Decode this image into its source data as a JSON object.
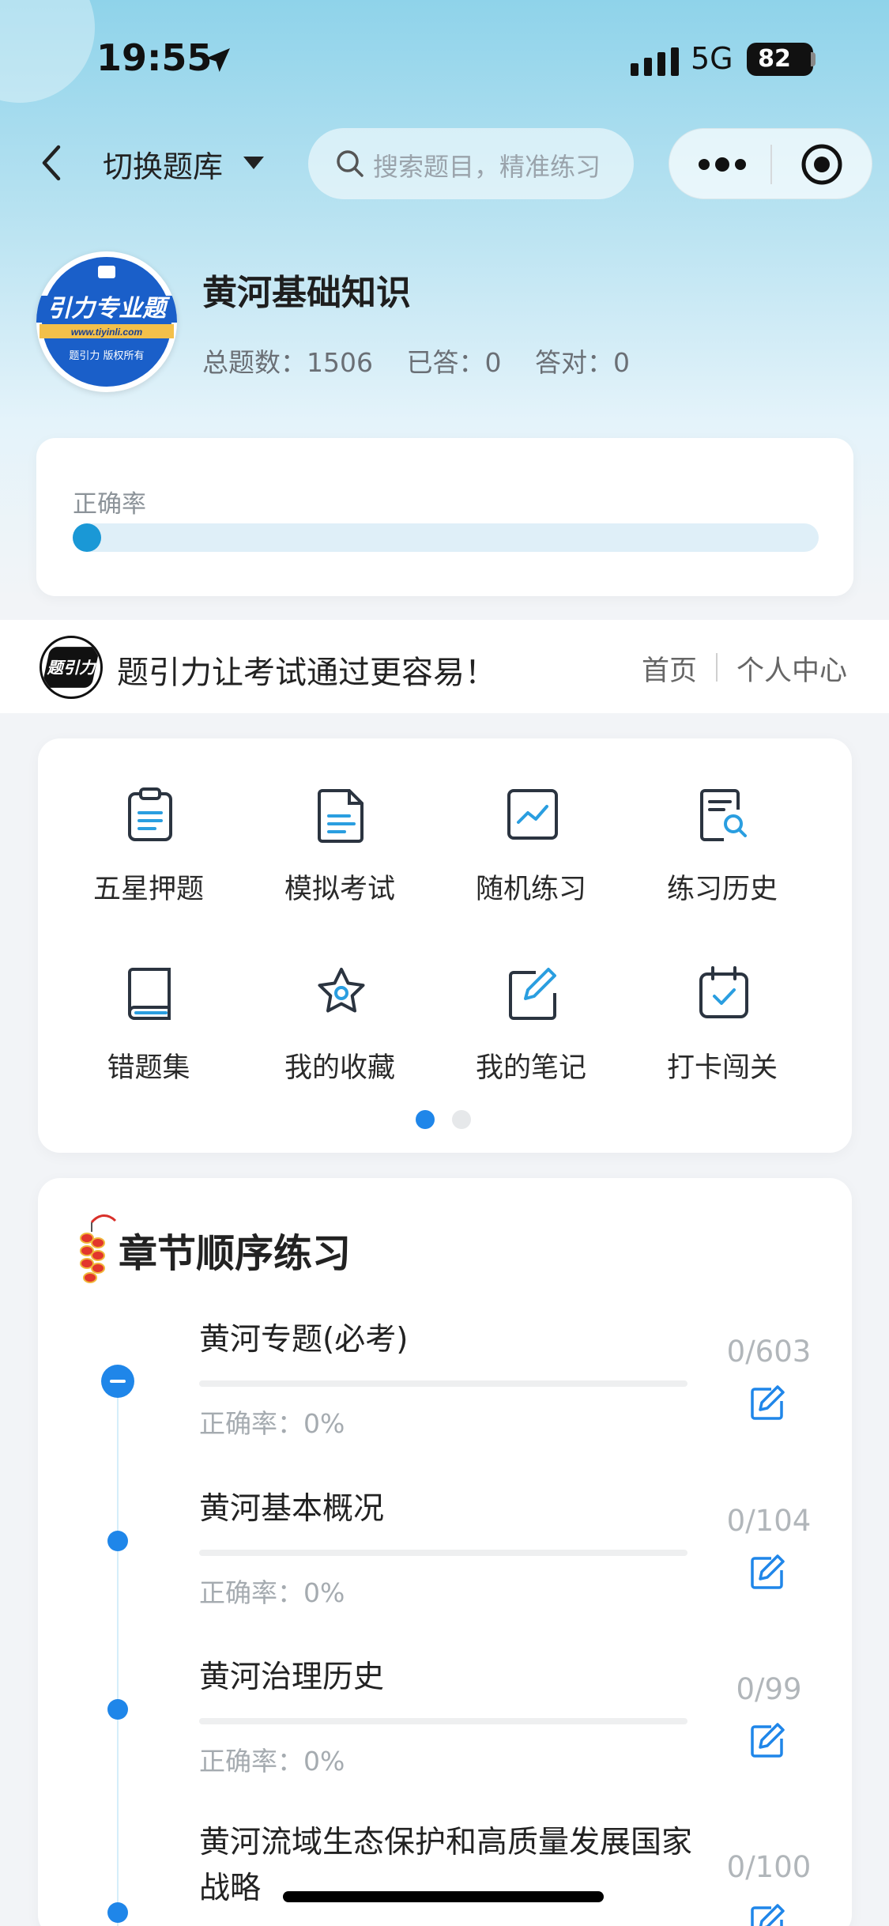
{
  "status_bar": {
    "time": "19:55",
    "network": "5G",
    "battery": "82"
  },
  "nav": {
    "title": "切换题库",
    "search_placeholder": "搜索题目，精准练习"
  },
  "bank": {
    "title": "黄河基础知识",
    "stats": [
      {
        "label": "总题数：",
        "value": "1506"
      },
      {
        "label": "已答：",
        "value": "0"
      },
      {
        "label": "答对：",
        "value": "0"
      }
    ],
    "accuracy_label": "正确率",
    "accuracy_value": 0,
    "logo_text": "引力专业题",
    "logo_url": "www.tiyinli.com",
    "logo_footer": "题引力 版权所有"
  },
  "banner": {
    "slogan": "题引力让考试通过更容易！",
    "home": "首页",
    "user_center": "个人中心",
    "logo_text": "题引力"
  },
  "grid": {
    "items": [
      {
        "label": "五星押题",
        "icon": "clipboard-icon"
      },
      {
        "label": "模拟考试",
        "icon": "document-icon"
      },
      {
        "label": "随机练习",
        "icon": "trend-chart-icon"
      },
      {
        "label": "练习历史",
        "icon": "search-document-icon"
      },
      {
        "label": "错题集",
        "icon": "book-icon"
      },
      {
        "label": "我的收藏",
        "icon": "star-icon"
      },
      {
        "label": "我的笔记",
        "icon": "note-edit-icon"
      },
      {
        "label": "打卡闯关",
        "icon": "calendar-check-icon"
      }
    ],
    "page_count": 2,
    "active_page": 1
  },
  "chapters": {
    "heading": "章节顺序练习",
    "items": [
      {
        "title": "黄河专题(必考)",
        "accuracy": "正确率：0%",
        "count": "0/603",
        "expanded": true
      },
      {
        "title": "黄河基本概况",
        "accuracy": "正确率：0%",
        "count": "0/104"
      },
      {
        "title": "黄河治理历史",
        "accuracy": "正确率：0%",
        "count": "0/99"
      },
      {
        "title": "黄河流域生态保护和高质量发展国家战略",
        "count": "0/100"
      }
    ]
  },
  "colors": {
    "accent": "#1f86e9",
    "progress": "#1a98d6",
    "icon_stroke": "#2b3440",
    "icon_accent": "#2a9ee0"
  }
}
